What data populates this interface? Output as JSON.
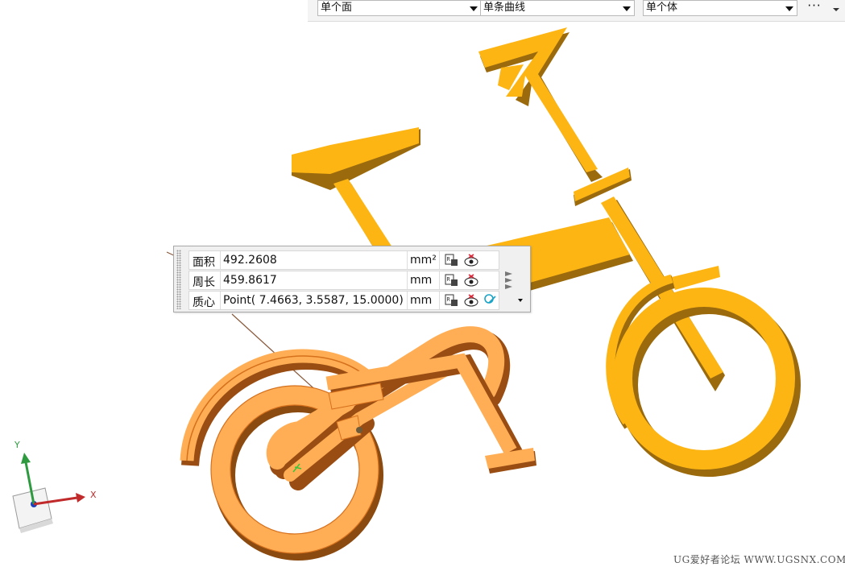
{
  "selection_filters": {
    "face_filter": "单个面",
    "curve_filter": "单条曲线",
    "body_filter": "单个体",
    "more_label": "···"
  },
  "measurement": {
    "rows": [
      {
        "label": "面积",
        "value": "492.2608",
        "unit": "mm²"
      },
      {
        "label": "周长",
        "value": "459.8617",
        "unit": "mm"
      },
      {
        "label": "质心",
        "value": "Point( 7.4663, 3.5587, 15.0000)",
        "unit": "mm"
      }
    ]
  },
  "triad": {
    "x_label": "X",
    "y_label": "Y"
  },
  "watermark": "UG爱好者论坛 WWW.UGSNX.COM",
  "colors": {
    "body_face": "#fdb514",
    "body_side": "#9a6a0d",
    "highlight_face": "#ffae55",
    "highlight_edge": "#d5701d"
  }
}
